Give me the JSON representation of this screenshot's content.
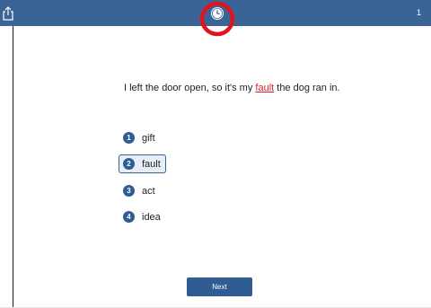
{
  "header": {
    "share_icon": "share-icon",
    "clock_icon": "clock-icon",
    "page_number": "1",
    "highlight_color": "#e0141c"
  },
  "question": {
    "before": "I left the door open, so it's my ",
    "answer": "fault",
    "after": " the dog ran in."
  },
  "choices": [
    {
      "number": "1",
      "label": "gift"
    },
    {
      "number": "2",
      "label": "fault",
      "selected": true
    },
    {
      "number": "3",
      "label": "act"
    },
    {
      "number": "4",
      "label": "idea"
    }
  ],
  "next_label": "Next",
  "colors": {
    "bar": "#3a6496",
    "accent": "#2f5d93",
    "answer": "#d6252a"
  }
}
